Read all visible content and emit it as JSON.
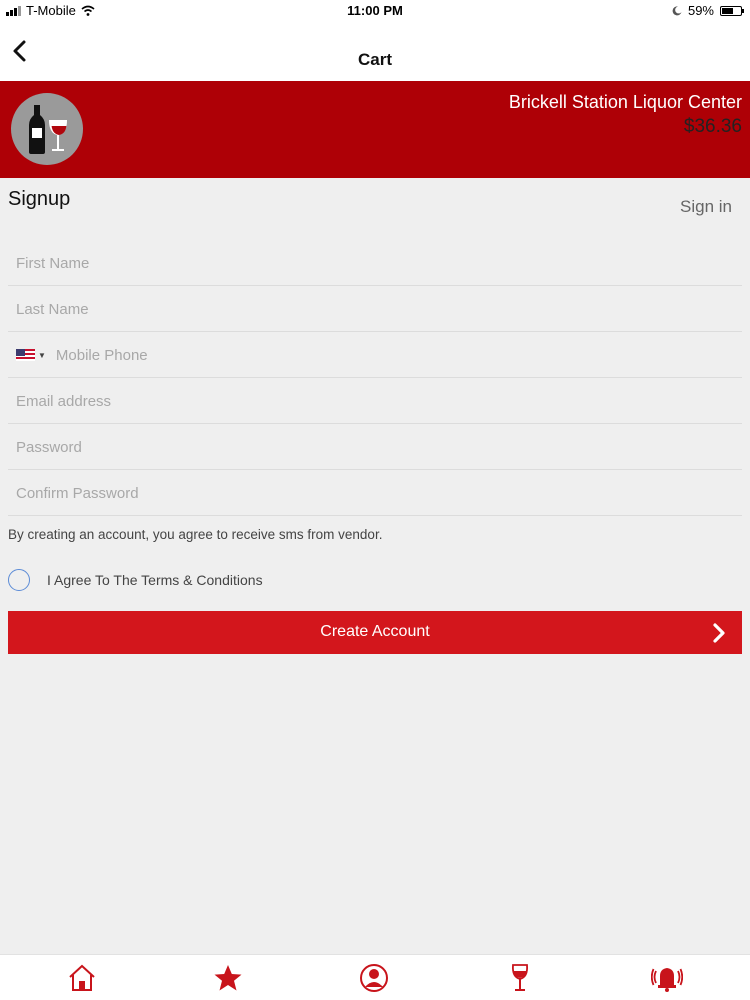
{
  "status_bar": {
    "carrier": "T-Mobile",
    "time": "11:00 PM",
    "battery_percent": "59%",
    "battery_level": 0.59
  },
  "nav": {
    "title": "Cart",
    "back_icon": "chevron-left-icon"
  },
  "store": {
    "name": "Brickell Station Liquor Center",
    "total": "$36.36",
    "logo_icon": "wine-bottle-glass-icon",
    "brand_color": "#ae0006"
  },
  "form": {
    "title": "Signup",
    "signin_label": "Sign in",
    "fields": {
      "first_name": {
        "placeholder": "First Name",
        "value": ""
      },
      "last_name": {
        "placeholder": "Last Name",
        "value": ""
      },
      "mobile_phone": {
        "placeholder": "Mobile Phone",
        "value": "",
        "country_flag": "us-flag-icon"
      },
      "email": {
        "placeholder": "Email address",
        "value": ""
      },
      "password": {
        "placeholder": "Password",
        "value": ""
      },
      "confirm_password": {
        "placeholder": "Confirm Password",
        "value": ""
      }
    },
    "sms_note": "By creating an account, you agree to receive sms from vendor.",
    "terms_label": "I Agree To The Terms & Conditions",
    "terms_checked": false,
    "submit_label": "Create Account",
    "submit_color": "#d3161c"
  },
  "tab_bar": {
    "icon_color": "#c8141b",
    "tabs": [
      {
        "icon": "home-icon"
      },
      {
        "icon": "star-icon"
      },
      {
        "icon": "user-icon"
      },
      {
        "icon": "wine-glass-icon"
      },
      {
        "icon": "alarm-bell-icon"
      }
    ]
  }
}
